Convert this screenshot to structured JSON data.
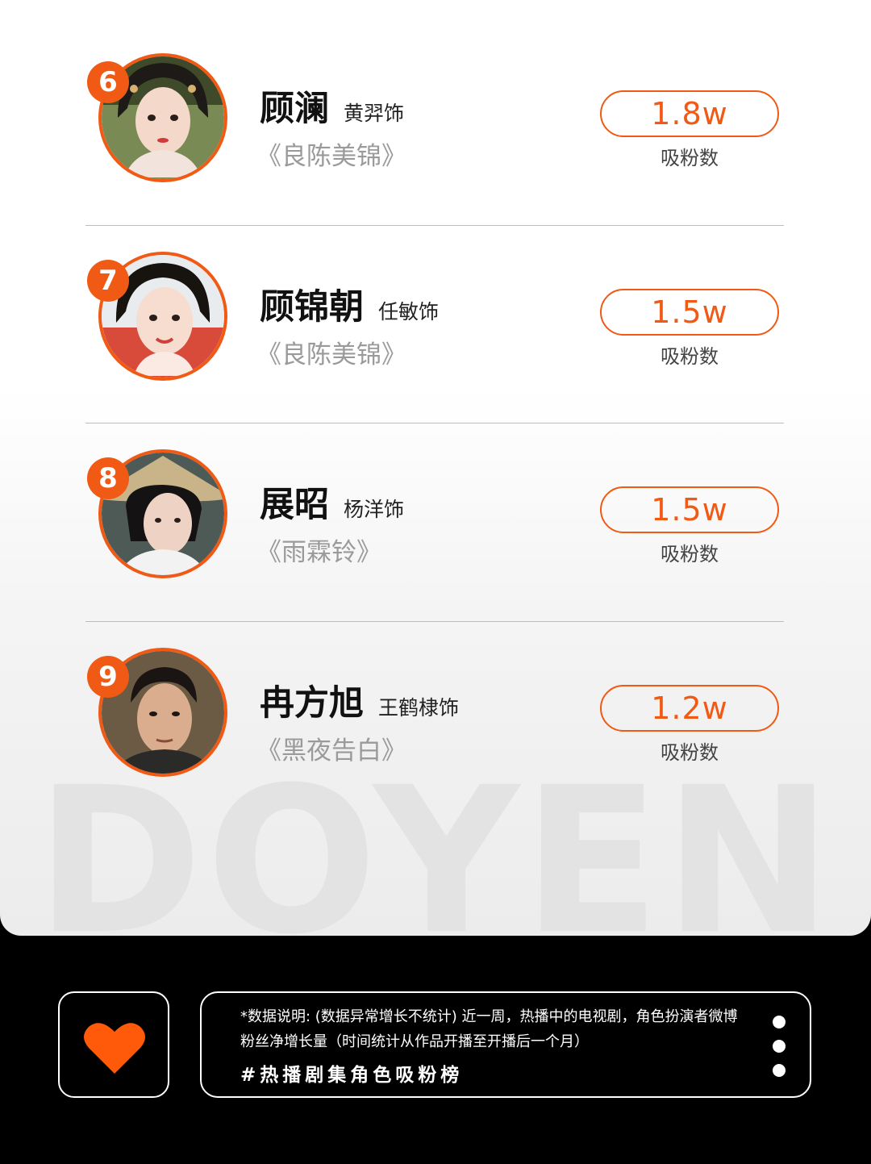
{
  "watermark": "DOYEN",
  "entries": [
    {
      "rank": "6",
      "character": "顾澜",
      "actor": "黄羿饰",
      "show": "《良陈美锦》",
      "count": "1.8w",
      "count_label": "吸粉数"
    },
    {
      "rank": "7",
      "character": "顾锦朝",
      "actor": "任敏饰",
      "show": "《良陈美锦》",
      "count": "1.5w",
      "count_label": "吸粉数"
    },
    {
      "rank": "8",
      "character": "展昭",
      "actor": "杨洋饰",
      "show": "《雨霖铃》",
      "count": "1.5w",
      "count_label": "吸粉数"
    },
    {
      "rank": "9",
      "character": "冉方旭",
      "actor": "王鹤棣饰",
      "show": "《黑夜告白》",
      "count": "1.2w",
      "count_label": "吸粉数"
    }
  ],
  "footer": {
    "note": "*数据说明: (数据异常增长不统计) 近一周，热播中的电视剧，角色扮演者微博粉丝净增长量（时间统计从作品开播至开播后一个月）",
    "tag": "#热播剧集角色吸粉榜"
  },
  "colors": {
    "accent": "#f05a14",
    "background_bottom": "#000000"
  },
  "icons": [
    "heart-icon",
    "more-dots-icon"
  ]
}
